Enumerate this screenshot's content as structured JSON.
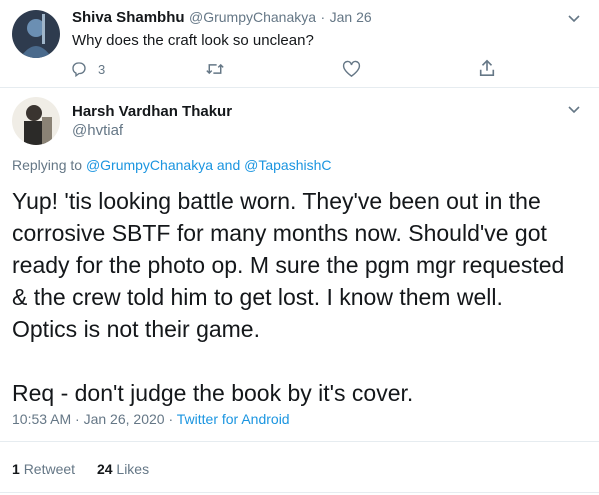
{
  "reply_tweet": {
    "name": "Shiva Shambhu",
    "handle": "@GrumpyChanakya",
    "separator": "·",
    "date": "Jan 26",
    "text": "Why does the craft look so unclean?",
    "reply_count": "3"
  },
  "main_tweet": {
    "name": "Harsh Vardhan Thakur",
    "handle": "@hvtiaf",
    "replying_prefix": "Replying to",
    "replying_user1": "@GrumpyChanakya",
    "replying_and": "and",
    "replying_user2": "@TapashishC",
    "line1": "Yup! 'tis looking battle worn. They've been out in the",
    "line2": "corrosive SBTF for many months now. Should've got",
    "line3": "ready for the photo op. M sure the pgm mgr requested",
    "line4": "& the crew told him to get lost. I know them well.",
    "line5": "Optics is not their game.",
    "line6": "Req - don't judge the book by it's cover.",
    "time": "10:53 AM · Jan 26, 2020",
    "dot": "·",
    "source": "Twitter for Android",
    "retweet_count": "1",
    "retweet_label": "Retweet",
    "like_count": "24",
    "like_label": "Likes"
  },
  "colors": {
    "link": "#1b95e0",
    "muted": "#657786",
    "divider": "#e6ecf0"
  }
}
